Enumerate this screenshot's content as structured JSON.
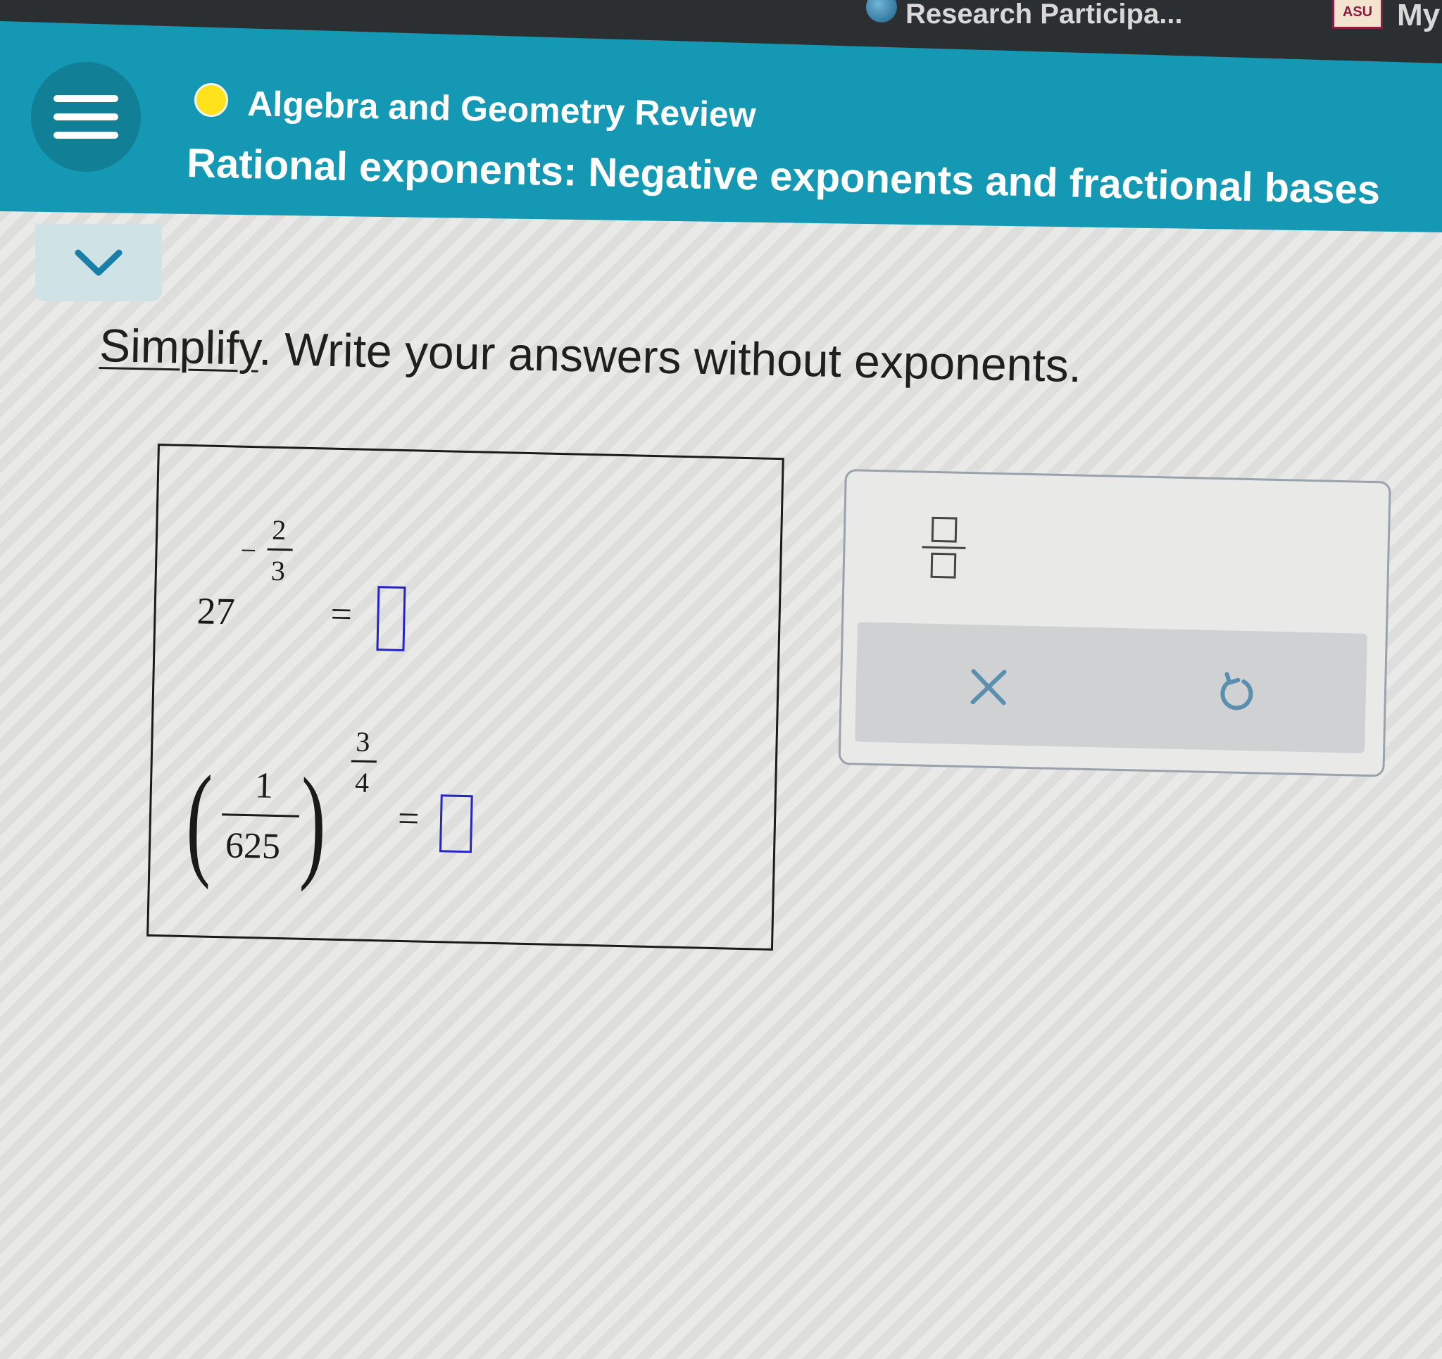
{
  "browser": {
    "bookmark_research": "Research Participa...",
    "bookmark_asu_icon": "ASU",
    "bookmark_my": "My"
  },
  "header": {
    "course_title": "Algebra and Geometry Review",
    "topic_title": "Rational exponents: Negative exponents and fractional bases",
    "status_dot_color": "#ffe21a",
    "band_color": "#1598b3"
  },
  "question": {
    "link_word": "Simplify",
    "instruction_rest": ". Write your answers without exponents."
  },
  "problems": [
    {
      "base": "27",
      "exp_sign": "−",
      "exp_num": "2",
      "exp_den": "3",
      "equals": "="
    },
    {
      "open_paren": "(",
      "close_paren": ")",
      "base_num": "1",
      "base_den": "625",
      "exp_num": "3",
      "exp_den": "4",
      "equals": "="
    }
  ],
  "keypad": {
    "fraction_icon": "fraction-template-icon",
    "clear_icon": "close-icon",
    "undo_icon": "undo-icon",
    "clear_symbol": "×",
    "icon_color": "#5a8fb0"
  }
}
